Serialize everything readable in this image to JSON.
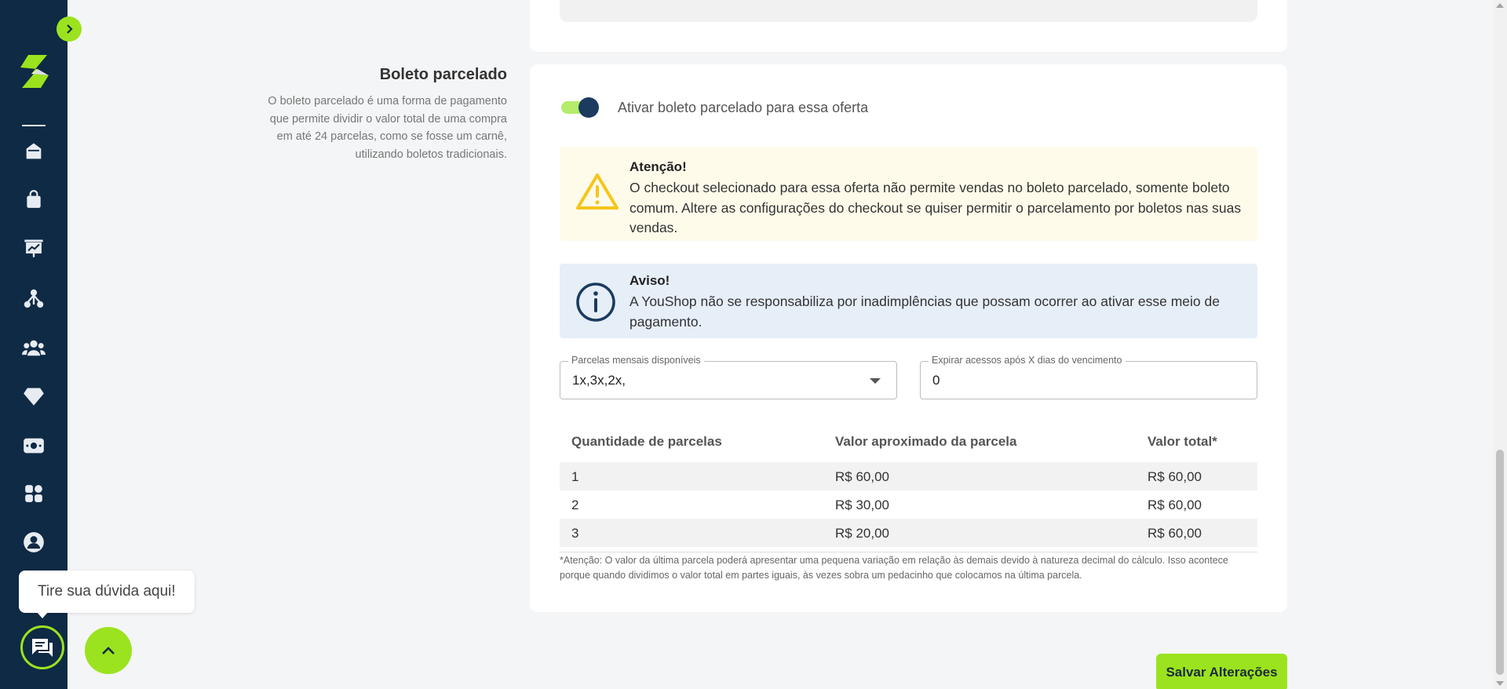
{
  "colors": {
    "accent_green": "#9be31e",
    "sidebar_navy": "#0f2a45",
    "warning_bg": "#fffbea",
    "warning_icon": "#f5c518",
    "info_bg": "#e6eef8",
    "info_icon": "#1b3b5f"
  },
  "sidebar": {
    "logo": "youshop-logo",
    "icons": [
      "home-icon",
      "shopping-bag-icon",
      "presentation-chart-icon",
      "network-icon",
      "users-icon",
      "diamond-icon",
      "money-icon",
      "apps-grid-icon",
      "user-circle-icon"
    ]
  },
  "section": {
    "title": "Boleto parcelado",
    "description": "O boleto parcelado é uma forma de pagamento que permite dividir o valor total de uma compra em até 24 parcelas, como se fosse um carnê, utilizando boletos tradicionais."
  },
  "toggle": {
    "label": "Ativar boleto parcelado para essa oferta",
    "enabled": true
  },
  "warning": {
    "icon": "warning-triangle-icon",
    "title": "Atenção!",
    "text": "O checkout selecionado para essa oferta não permite vendas no boleto parcelado, somente boleto comum. Altere as configurações do checkout se quiser permitir o parcelamento por boletos nas suas vendas."
  },
  "info": {
    "icon": "info-circle-icon",
    "title": "Aviso!",
    "text": "A YouShop não se responsabiliza por inadimplências que possam ocorrer ao ativar esse meio de pagamento."
  },
  "fields": {
    "installments": {
      "label": "Parcelas mensais disponíveis",
      "value": "1x,3x,2x,"
    },
    "expire": {
      "label": "Expirar acessos após X dias do vencimento",
      "value": "0"
    }
  },
  "table": {
    "headers": [
      "Quantidade de parcelas",
      "Valor aproximado da parcela",
      "Valor total*"
    ],
    "rows": [
      [
        "1",
        "R$ 60,00",
        "R$ 60,00"
      ],
      [
        "2",
        "R$ 30,00",
        "R$ 60,00"
      ],
      [
        "3",
        "R$ 20,00",
        "R$ 60,00"
      ]
    ]
  },
  "footnote": "*Atenção: O valor da última parcela poderá apresentar uma pequena variação em relação às demais devido à natureza decimal do cálculo. Isso acontece porque quando dividimos o valor total em partes iguais, às vezes sobra um pedacinho que colocamos na última parcela.",
  "save_button": "Salvar Alterações",
  "help": {
    "tooltip": "Tire sua dúvida aqui!"
  }
}
